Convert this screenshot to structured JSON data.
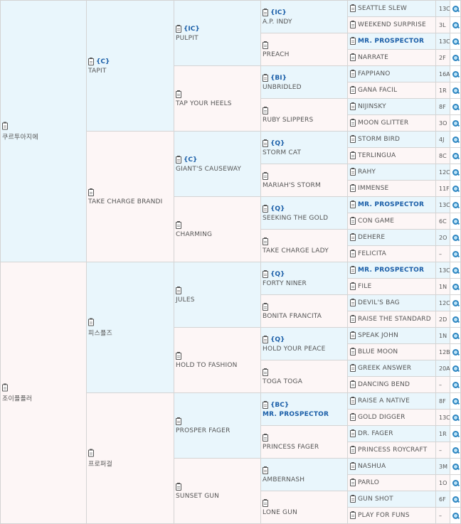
{
  "pedigree": [
    {
      "gen": 1,
      "name": "쿠르투아지에",
      "sex": "m",
      "badge": "",
      "bold": false
    },
    {
      "gen": 2,
      "name": "TAPIT",
      "sex": "m",
      "badge": "{C}",
      "bold": false
    },
    {
      "gen": 3,
      "name": "PULPIT",
      "sex": "m",
      "badge": "{IC}",
      "bold": false
    },
    {
      "gen": 4,
      "name": "A.P. INDY",
      "sex": "m",
      "badge": "{IC}",
      "bold": false
    },
    {
      "gen": 5,
      "name": "SEATTLE SLEW",
      "sex": "m",
      "badge": "",
      "bold": false,
      "code": "13C"
    },
    {
      "gen": 5,
      "name": "WEEKEND SURPRISE",
      "sex": "f",
      "badge": "",
      "bold": false,
      "code": "3L"
    },
    {
      "gen": 4,
      "name": "PREACH",
      "sex": "f",
      "badge": "",
      "bold": false
    },
    {
      "gen": 5,
      "name": "MR. PROSPECTOR",
      "sex": "m",
      "badge": "",
      "bold": true,
      "code": "13C"
    },
    {
      "gen": 5,
      "name": "NARRATE",
      "sex": "f",
      "badge": "",
      "bold": false,
      "code": "2F"
    },
    {
      "gen": 3,
      "name": "TAP YOUR HEELS",
      "sex": "f",
      "badge": "",
      "bold": false
    },
    {
      "gen": 4,
      "name": "UNBRIDLED",
      "sex": "m",
      "badge": "{BI}",
      "bold": false
    },
    {
      "gen": 5,
      "name": "FAPPIANO",
      "sex": "m",
      "badge": "",
      "bold": false,
      "code": "16A"
    },
    {
      "gen": 5,
      "name": "GANA FACIL",
      "sex": "f",
      "badge": "",
      "bold": false,
      "code": "1R"
    },
    {
      "gen": 4,
      "name": "RUBY SLIPPERS",
      "sex": "f",
      "badge": "",
      "bold": false
    },
    {
      "gen": 5,
      "name": "NIJINSKY",
      "sex": "m",
      "badge": "",
      "bold": false,
      "code": "8F"
    },
    {
      "gen": 5,
      "name": "MOON GLITTER",
      "sex": "f",
      "badge": "",
      "bold": false,
      "code": "3O"
    },
    {
      "gen": 2,
      "name": "TAKE CHARGE BRANDI",
      "sex": "f",
      "badge": "",
      "bold": false
    },
    {
      "gen": 3,
      "name": "GIANT'S CAUSEWAY",
      "sex": "m",
      "badge": "{C}",
      "bold": false
    },
    {
      "gen": 4,
      "name": "STORM CAT",
      "sex": "m",
      "badge": "{Q}",
      "bold": false
    },
    {
      "gen": 5,
      "name": "STORM BIRD",
      "sex": "m",
      "badge": "",
      "bold": false,
      "code": "4J"
    },
    {
      "gen": 5,
      "name": "TERLINGUA",
      "sex": "f",
      "badge": "",
      "bold": false,
      "code": "8C"
    },
    {
      "gen": 4,
      "name": "MARIAH'S STORM",
      "sex": "f",
      "badge": "",
      "bold": false
    },
    {
      "gen": 5,
      "name": "RAHY",
      "sex": "m",
      "badge": "",
      "bold": false,
      "code": "12C"
    },
    {
      "gen": 5,
      "name": "IMMENSE",
      "sex": "f",
      "badge": "",
      "bold": false,
      "code": "11F"
    },
    {
      "gen": 3,
      "name": "CHARMING",
      "sex": "f",
      "badge": "",
      "bold": false
    },
    {
      "gen": 4,
      "name": "SEEKING THE GOLD",
      "sex": "m",
      "badge": "{Q}",
      "bold": false
    },
    {
      "gen": 5,
      "name": "MR. PROSPECTOR",
      "sex": "m",
      "badge": "",
      "bold": true,
      "code": "13C"
    },
    {
      "gen": 5,
      "name": "CON GAME",
      "sex": "f",
      "badge": "",
      "bold": false,
      "code": "6C"
    },
    {
      "gen": 4,
      "name": "TAKE CHARGE LADY",
      "sex": "f",
      "badge": "",
      "bold": false
    },
    {
      "gen": 5,
      "name": "DEHERE",
      "sex": "m",
      "badge": "",
      "bold": false,
      "code": "2O"
    },
    {
      "gen": 5,
      "name": "FELICITA",
      "sex": "f",
      "badge": "",
      "bold": false,
      "code": "–"
    },
    {
      "gen": 1,
      "name": "조이플플러",
      "sex": "f",
      "badge": "",
      "bold": false
    },
    {
      "gen": 2,
      "name": "피스플즈",
      "sex": "m",
      "badge": "",
      "bold": false
    },
    {
      "gen": 3,
      "name": "JULES",
      "sex": "m",
      "badge": "",
      "bold": false
    },
    {
      "gen": 4,
      "name": "FORTY NINER",
      "sex": "m",
      "badge": "{Q}",
      "bold": false
    },
    {
      "gen": 5,
      "name": "MR. PROSPECTOR",
      "sex": "m",
      "badge": "",
      "bold": true,
      "code": "13C"
    },
    {
      "gen": 5,
      "name": "FILE",
      "sex": "f",
      "badge": "",
      "bold": false,
      "code": "1N"
    },
    {
      "gen": 4,
      "name": "BONITA FRANCITA",
      "sex": "f",
      "badge": "",
      "bold": false
    },
    {
      "gen": 5,
      "name": "DEVIL'S BAG",
      "sex": "m",
      "badge": "",
      "bold": false,
      "code": "12C"
    },
    {
      "gen": 5,
      "name": "RAISE THE STANDARD",
      "sex": "f",
      "badge": "",
      "bold": false,
      "code": "2D"
    },
    {
      "gen": 3,
      "name": "HOLD TO FASHION",
      "sex": "f",
      "badge": "",
      "bold": false
    },
    {
      "gen": 4,
      "name": "HOLD YOUR PEACE",
      "sex": "m",
      "badge": "{Q}",
      "bold": false
    },
    {
      "gen": 5,
      "name": "SPEAK JOHN",
      "sex": "m",
      "badge": "",
      "bold": false,
      "code": "1N"
    },
    {
      "gen": 5,
      "name": "BLUE MOON",
      "sex": "f",
      "badge": "",
      "bold": false,
      "code": "12B"
    },
    {
      "gen": 4,
      "name": "TOGA TOGA",
      "sex": "f",
      "badge": "",
      "bold": false
    },
    {
      "gen": 5,
      "name": "GREEK ANSWER",
      "sex": "m",
      "badge": "",
      "bold": false,
      "code": "20A"
    },
    {
      "gen": 5,
      "name": "DANCING BEND",
      "sex": "f",
      "badge": "",
      "bold": false,
      "code": "–"
    },
    {
      "gen": 2,
      "name": "프로퍼걸",
      "sex": "f",
      "badge": "",
      "bold": false
    },
    {
      "gen": 3,
      "name": "PROSPER FAGER",
      "sex": "m",
      "badge": "",
      "bold": false
    },
    {
      "gen": 4,
      "name": "MR. PROSPECTOR",
      "sex": "m",
      "badge": "{BC}",
      "bold": true
    },
    {
      "gen": 5,
      "name": "RAISE A NATIVE",
      "sex": "m",
      "badge": "",
      "bold": false,
      "code": "8F"
    },
    {
      "gen": 5,
      "name": "GOLD DIGGER",
      "sex": "f",
      "badge": "",
      "bold": false,
      "code": "13C"
    },
    {
      "gen": 4,
      "name": "PRINCESS FAGER",
      "sex": "f",
      "badge": "",
      "bold": false
    },
    {
      "gen": 5,
      "name": "DR. FAGER",
      "sex": "m",
      "badge": "",
      "bold": false,
      "code": "1R"
    },
    {
      "gen": 5,
      "name": "PRINCESS ROYCRAFT",
      "sex": "f",
      "badge": "",
      "bold": false,
      "code": "–"
    },
    {
      "gen": 3,
      "name": "SUNSET GUN",
      "sex": "f",
      "badge": "",
      "bold": false
    },
    {
      "gen": 4,
      "name": "AMBERNASH",
      "sex": "m",
      "badge": "",
      "bold": false
    },
    {
      "gen": 5,
      "name": "NASHUA",
      "sex": "m",
      "badge": "",
      "bold": false,
      "code": "3M"
    },
    {
      "gen": 5,
      "name": "PARLO",
      "sex": "f",
      "badge": "",
      "bold": false,
      "code": "1O"
    },
    {
      "gen": 4,
      "name": "LONE GUN",
      "sex": "f",
      "badge": "",
      "bold": false
    },
    {
      "gen": 5,
      "name": "GUN SHOT",
      "sex": "m",
      "badge": "",
      "bold": false,
      "code": "6F"
    },
    {
      "gen": 5,
      "name": "PLAY FOR FUNS",
      "sex": "f",
      "badge": "",
      "bold": false,
      "code": "–"
    }
  ],
  "icons": {
    "document": "document-icon",
    "search": "search-icon"
  },
  "colors": {
    "male_bg": "#e9f6fc",
    "female_bg": "#fdf6f6",
    "accent": "#1a5ea8"
  }
}
